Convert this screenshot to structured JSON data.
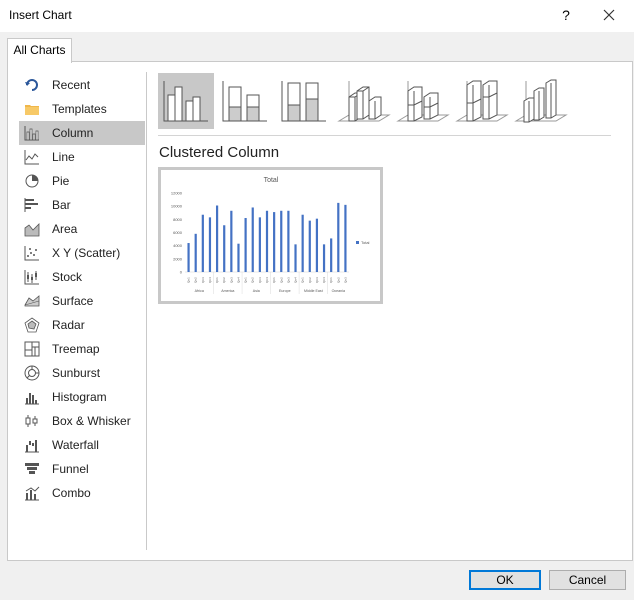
{
  "window": {
    "title": "Insert Chart",
    "help_label": "?"
  },
  "tabs": [
    {
      "label": "All Charts"
    }
  ],
  "categories": [
    {
      "label": "Recent",
      "icon": "recent-icon"
    },
    {
      "label": "Templates",
      "icon": "folder-icon"
    },
    {
      "label": "Column",
      "icon": "column-chart-icon",
      "selected": true
    },
    {
      "label": "Line",
      "icon": "line-chart-icon"
    },
    {
      "label": "Pie",
      "icon": "pie-chart-icon"
    },
    {
      "label": "Bar",
      "icon": "bar-chart-icon"
    },
    {
      "label": "Area",
      "icon": "area-chart-icon"
    },
    {
      "label": "X Y (Scatter)",
      "icon": "scatter-chart-icon"
    },
    {
      "label": "Stock",
      "icon": "stock-chart-icon"
    },
    {
      "label": "Surface",
      "icon": "surface-chart-icon"
    },
    {
      "label": "Radar",
      "icon": "radar-chart-icon"
    },
    {
      "label": "Treemap",
      "icon": "treemap-chart-icon"
    },
    {
      "label": "Sunburst",
      "icon": "sunburst-chart-icon"
    },
    {
      "label": "Histogram",
      "icon": "histogram-chart-icon"
    },
    {
      "label": "Box & Whisker",
      "icon": "box-whisker-chart-icon"
    },
    {
      "label": "Waterfall",
      "icon": "waterfall-chart-icon"
    },
    {
      "label": "Funnel",
      "icon": "funnel-chart-icon"
    },
    {
      "label": "Combo",
      "icon": "combo-chart-icon"
    }
  ],
  "subtypes": [
    {
      "icon": "clustered-column-icon",
      "selected": true
    },
    {
      "icon": "stacked-column-icon"
    },
    {
      "icon": "100-stacked-column-icon"
    },
    {
      "icon": "3d-clustered-column-icon"
    },
    {
      "icon": "3d-stacked-column-icon"
    },
    {
      "icon": "3d-100-stacked-column-icon"
    },
    {
      "icon": "3d-column-icon"
    }
  ],
  "selected_subtype_name": "Clustered Column",
  "preview": {
    "title": "Total",
    "legend": "Total",
    "y_ticks": [
      "0",
      "2000",
      "4000",
      "6000",
      "8000",
      "10000",
      "12000"
    ],
    "groups": [
      "Africa",
      "America",
      "Asia",
      "Europe",
      "Middle East",
      "Oceania"
    ],
    "quarter_labels": [
      "Qtr1",
      "Qtr2",
      "Qtr3",
      "Qtr4"
    ],
    "values": [
      4400,
      5800,
      8700,
      8300,
      10100,
      7100,
      9300,
      4300,
      8200,
      9800,
      8300,
      9300,
      9100,
      9300,
      9300,
      4200,
      8700,
      7800,
      8100,
      4200,
      5100,
      10500,
      10200
    ],
    "bar_color": "#4472c4"
  },
  "buttons": {
    "ok": "OK",
    "cancel": "Cancel"
  }
}
